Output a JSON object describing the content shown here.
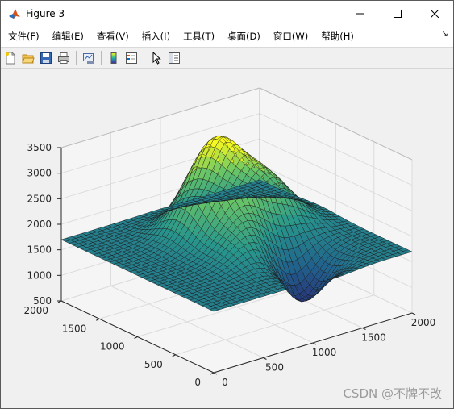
{
  "window": {
    "title": "Figure 3"
  },
  "menu": {
    "items": [
      "文件(F)",
      "编辑(E)",
      "查看(V)",
      "插入(I)",
      "工具(T)",
      "桌面(D)",
      "窗口(W)",
      "帮助(H)"
    ]
  },
  "toolbar": {
    "buttons": [
      "new-figure-icon",
      "open-file-icon",
      "save-icon",
      "print-icon",
      "link-plot-icon",
      "insert-colorbar-icon",
      "insert-legend-icon",
      "edit-plot-arrow-icon",
      "property-inspector-icon"
    ]
  },
  "colors": {
    "accent": "#0072bd",
    "colormap_low": "#440154",
    "colormap_mid": "#21918c",
    "colormap_high": "#fde725"
  },
  "chart_data": {
    "type": "surface",
    "colormap": "parula",
    "x_range": [
      0,
      2000
    ],
    "y_range": [
      0,
      2000
    ],
    "z_range": [
      500,
      3500
    ],
    "x_ticks": [
      "0",
      "500",
      "1000",
      "1500",
      "2000"
    ],
    "y_ticks": [
      "0",
      "500",
      "1000",
      "1500",
      "2000"
    ],
    "z_ticks": [
      "500",
      "1000",
      "1500",
      "2000",
      "2500",
      "3000",
      "3500"
    ],
    "base_level": 1700,
    "peaks": [
      {
        "x": 1000,
        "y": 1300,
        "z": 3450
      },
      {
        "x": 1450,
        "y": 1200,
        "z": 2600
      },
      {
        "x": 1000,
        "y": 700,
        "z": 2500
      }
    ],
    "valleys": [
      {
        "x": 1200,
        "y": 500,
        "z": 550
      }
    ],
    "grid": true
  },
  "watermark": "CSDN @不牌不改"
}
